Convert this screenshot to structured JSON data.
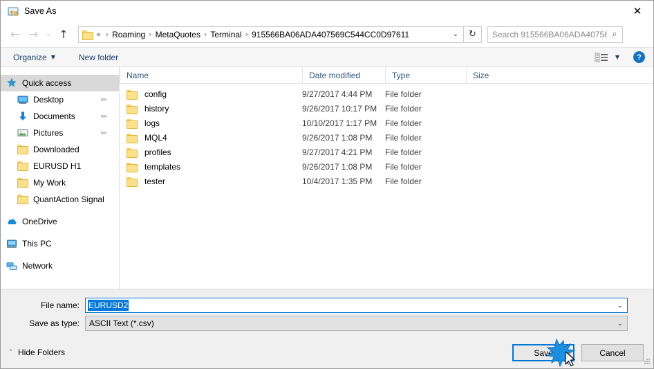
{
  "window": {
    "title": "Save As",
    "title_icon": "save-as-icon",
    "close_label": "✕"
  },
  "nav": {
    "back_icon": "←",
    "forward_icon": "→",
    "recent_icon": "⌄",
    "up_icon": "↑",
    "address": {
      "folder_icon": "folder-icon",
      "overflow": "«",
      "crumbs": [
        "Roaming",
        "MetaQuotes",
        "Terminal",
        "915566BA06ADA407569C544CC0D97611"
      ],
      "separator": "›",
      "dropdown_icon": "⌄"
    },
    "refresh_icon": "↻",
    "search": {
      "placeholder": "Search 915566BA06ADA40756...",
      "icon": "⌕"
    }
  },
  "command_bar": {
    "organize": "Organize",
    "organize_caret": "▼",
    "new_folder": "New folder",
    "view_icon": "list-view-icon",
    "view_caret": "▼",
    "help_label": "?"
  },
  "sidebar": {
    "items": [
      {
        "label": "Quick access",
        "icon": "star-icon",
        "selected": true,
        "indent": false,
        "pinned": false
      },
      {
        "label": "Desktop",
        "icon": "desktop-icon",
        "selected": false,
        "indent": true,
        "pinned": true
      },
      {
        "label": "Documents",
        "icon": "documents-icon",
        "selected": false,
        "indent": true,
        "pinned": true
      },
      {
        "label": "Pictures",
        "icon": "pictures-icon",
        "selected": false,
        "indent": true,
        "pinned": true
      },
      {
        "label": "Downloaded",
        "icon": "folder-icon",
        "selected": false,
        "indent": true,
        "pinned": false
      },
      {
        "label": "EURUSD H1",
        "icon": "folder-icon",
        "selected": false,
        "indent": true,
        "pinned": false
      },
      {
        "label": "My Work",
        "icon": "folder-icon",
        "selected": false,
        "indent": true,
        "pinned": false
      },
      {
        "label": "QuantAction Signal",
        "icon": "folder-icon",
        "selected": false,
        "indent": true,
        "pinned": false
      },
      {
        "label": "OneDrive",
        "icon": "onedrive-icon",
        "selected": false,
        "indent": false,
        "pinned": false,
        "gap_before": true
      },
      {
        "label": "This PC",
        "icon": "thispc-icon",
        "selected": false,
        "indent": false,
        "pinned": false,
        "gap_before": true
      },
      {
        "label": "Network",
        "icon": "network-icon",
        "selected": false,
        "indent": false,
        "pinned": false,
        "gap_before": true
      }
    ],
    "pin_glyph": "✐"
  },
  "file_list": {
    "sort_caret": "˄",
    "columns": [
      "Name",
      "Date modified",
      "Type",
      "Size"
    ],
    "rows": [
      {
        "name": "config",
        "date": "9/27/2017 4:44 PM",
        "type": "File folder",
        "size": ""
      },
      {
        "name": "history",
        "date": "9/26/2017 10:17 PM",
        "type": "File folder",
        "size": ""
      },
      {
        "name": "logs",
        "date": "10/10/2017 1:17 PM",
        "type": "File folder",
        "size": ""
      },
      {
        "name": "MQL4",
        "date": "9/26/2017 1:08 PM",
        "type": "File folder",
        "size": ""
      },
      {
        "name": "profiles",
        "date": "9/27/2017 4:21 PM",
        "type": "File folder",
        "size": ""
      },
      {
        "name": "templates",
        "date": "9/26/2017 1:08 PM",
        "type": "File folder",
        "size": ""
      },
      {
        "name": "tester",
        "date": "10/4/2017 1:35 PM",
        "type": "File folder",
        "size": ""
      }
    ]
  },
  "bottom": {
    "filename_label": "File name:",
    "filename_value": "EURUSD2",
    "filetype_label": "Save as type:",
    "filetype_value": "ASCII Text (*.csv)",
    "combo_arrow": "⌄",
    "hide_folders": "Hide Folders",
    "hide_caret": "˄",
    "save_label": "Save",
    "cancel_label": "Cancel"
  },
  "colors": {
    "accent": "#0078d7",
    "folder_yellow": "#fde08a",
    "help_blue": "#1173c2",
    "header_text": "#33557a"
  }
}
